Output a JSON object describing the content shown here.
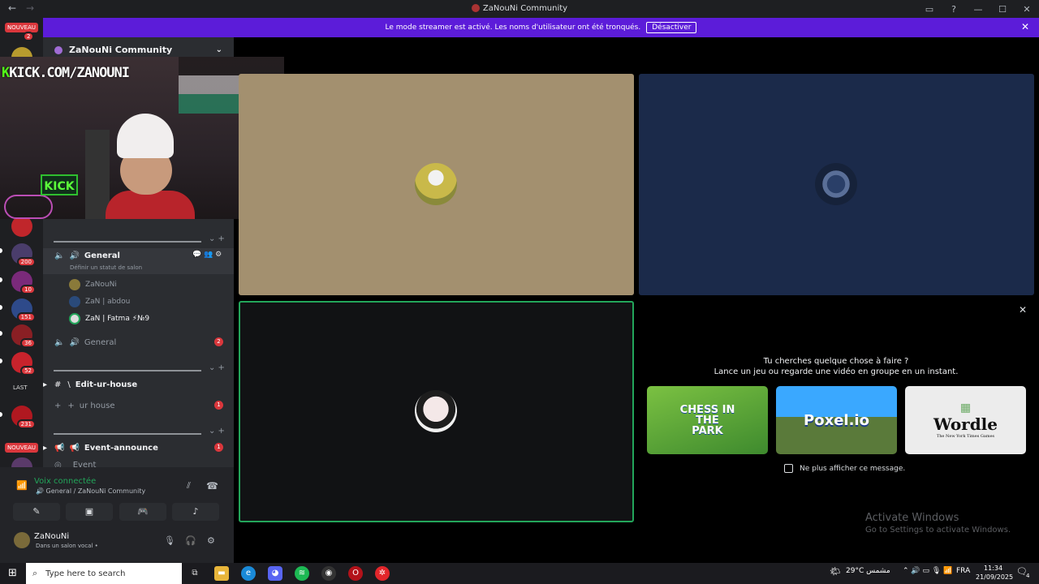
{
  "window": {
    "title": "ZaNouNi Community",
    "back_icon": "←",
    "forward_icon": "→",
    "controls": [
      "▭",
      "?",
      "—",
      "☐",
      "✕"
    ]
  },
  "banner": {
    "text": "Le mode streamer est activé. Les noms d'utilisateur ont été tronqués.",
    "button": "Désactiver",
    "close": "✕"
  },
  "servers": {
    "new_label_top": "NOUVEAU",
    "new_label_top_count": "2",
    "badges": [
      "200",
      "10",
      "151",
      "36",
      "52",
      "231"
    ],
    "new_label_bottom": "NOUVEAU",
    "last_label": "LAST"
  },
  "guild": {
    "name": "ZaNouNi Community",
    "chevron": "⌄"
  },
  "stream_overlay": {
    "kick_prefix": "K",
    "kick_text": "KICK.COM/ZANOUNI",
    "sign": "KICK"
  },
  "channels": {
    "voice_active": {
      "name": "General",
      "status_hint": "Définir un statut de salon",
      "users": [
        {
          "name": "ZaNouNi"
        },
        {
          "name": "ZaN | abdou"
        },
        {
          "name": "ZaN | Fatma ⚡№9"
        }
      ]
    },
    "voice_second": {
      "name": "General",
      "badge": "2"
    },
    "text_edit": {
      "name": "Edit-ur-house"
    },
    "forum_house": {
      "name": "ur house",
      "badge": "1"
    },
    "announce": {
      "name": "Event-announce",
      "badge": "1"
    },
    "event_partial": {
      "name": "Event"
    }
  },
  "voice_panel": {
    "status": "Voix connectée",
    "location": "General / ZaNouNi Community"
  },
  "me": {
    "name": "ZaNouNi",
    "sub": "Dans un salon vocal •"
  },
  "activity": {
    "line1": "Tu cherches quelque chose à faire ?",
    "line2": "Lance un jeu ou regarde une vidéo en groupe en un instant.",
    "games": [
      {
        "name": "CHESS IN THE PARK"
      },
      {
        "name": "Poxel.io"
      },
      {
        "name": "Wordle",
        "sub": "The New York Times Games"
      }
    ],
    "dont_show": "Ne plus afficher ce message."
  },
  "watermark": {
    "title": "Activate Windows",
    "sub": "Go to Settings to activate Windows."
  },
  "taskbar": {
    "search_placeholder": "Type here to search",
    "weather": "29°C مشمس",
    "language": "FRA",
    "time": "11:34",
    "date": "21/09/2025",
    "notif_count": "4"
  },
  "colors": {
    "banner": "#5c1cd9",
    "tile_tan": "#a3906f",
    "tile_navy": "#1b2a4a",
    "speaking_border": "#23a55a",
    "badge_red": "#da373c"
  }
}
